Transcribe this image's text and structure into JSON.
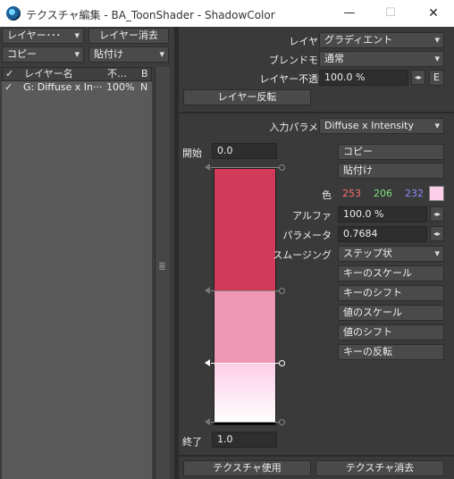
{
  "window": {
    "title": "テクスチャ編集 - BA_ToonShader - ShadowColor",
    "minimize": "—",
    "maximize": "☐",
    "close": "✕"
  },
  "left": {
    "layer_dropdown": "レイヤー･･･",
    "layer_delete": "レイヤー消去",
    "copy_dropdown": "コピー",
    "paste_dropdown": "貼付け",
    "columns": {
      "check": "✓",
      "name": "レイヤー名",
      "opacity": "不…",
      "blend": "B"
    },
    "rows": [
      {
        "check": "✓",
        "name": "G: Diffuse x In···",
        "opacity": "100%",
        "blend": "N"
      }
    ]
  },
  "right": {
    "layer_type_label": "レイヤー種",
    "layer_type_value": "グラディエント",
    "blend_mode_label": "ブレンドモード",
    "blend_mode_value": "通常",
    "layer_opacity_label": "レイヤー不透明度",
    "layer_opacity_value": "100.0 %",
    "envelope_button": "E",
    "layer_invert": "レイヤー反転",
    "input_param_label": "入力パラメータ",
    "input_param_value": "Diffuse x Intensity",
    "start_label": "開始",
    "start_value": "0.0",
    "end_label": "終了",
    "end_value": "1.0",
    "copy": "コピー",
    "paste": "貼付け",
    "color_label": "色",
    "color_r": "253",
    "color_g": "206",
    "color_b": "232",
    "alpha_label": "アルファ",
    "alpha_value": "100.0 %",
    "param_label": "パラメータ",
    "param_value": "0.7684",
    "smoothing_label": "スムージング",
    "smoothing_value": "ステップ状",
    "key_scale": "キーのスケール",
    "key_shift": "キーのシフト",
    "value_scale": "値のスケール",
    "value_shift": "値のシフト",
    "key_invert": "キーの反転",
    "texture_use": "テクスチャ使用",
    "texture_delete": "テクスチャ消去"
  },
  "gradient_colors": {
    "seg1": "#d13a58",
    "seg2": "#ef98b6",
    "seg3_top": "#fdcee8",
    "seg3_bottom": "#ffffff",
    "swatch": "#fdcee8",
    "r_text": "#ff6d6d",
    "g_text": "#7de07d",
    "b_text": "#8a8aff"
  }
}
